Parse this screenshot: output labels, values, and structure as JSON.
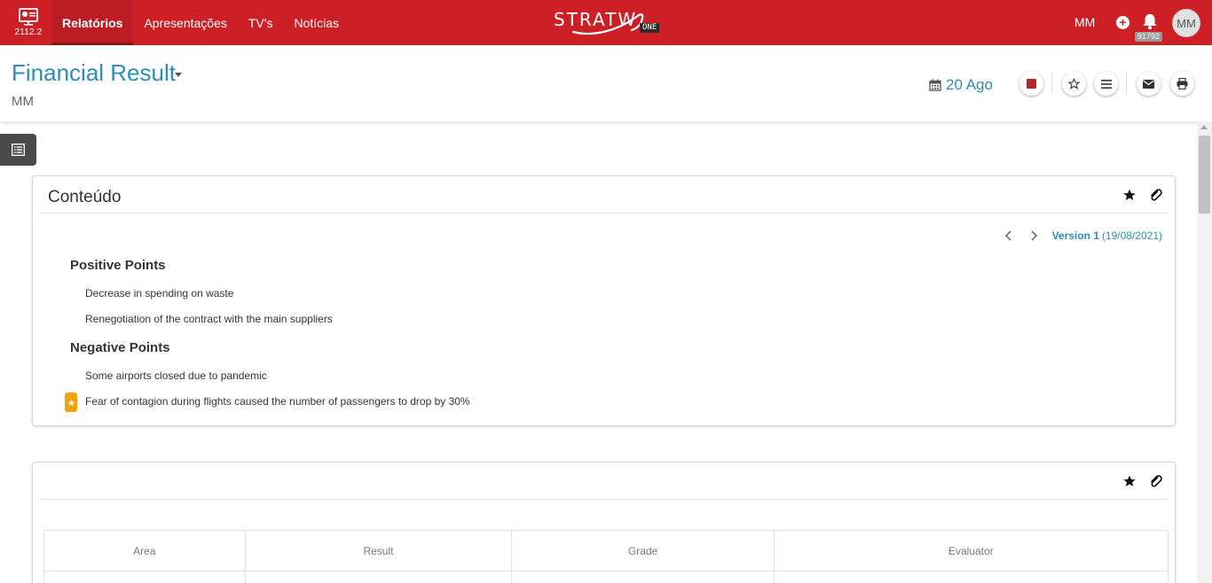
{
  "app": {
    "version": "2112.2",
    "brand_word": "STRATW",
    "brand_badge": "ONE",
    "accent_color": "#cc1f26",
    "link_color": "#2a8fb4"
  },
  "nav": {
    "items": [
      {
        "label": "Relatórios",
        "active": true
      },
      {
        "label": "Apresentações",
        "active": false
      },
      {
        "label": "TV's",
        "active": false
      },
      {
        "label": "Notícias",
        "active": false
      }
    ]
  },
  "user": {
    "initials": "MM",
    "avatar_initials": "MM",
    "notification_count": "91792"
  },
  "header": {
    "title": "Financial Result",
    "subtitle": "MM",
    "date": "20 Ago"
  },
  "content_card": {
    "title": "Conteúdo",
    "version_label": "Version 1",
    "version_date": "(19/08/2021)",
    "positive": {
      "heading": "Positive Points",
      "items": [
        "Decrease in spending on waste",
        "Renegotiation of the contract with the main suppliers"
      ]
    },
    "negative": {
      "heading": "Negative Points",
      "items": [
        "Some airports closed due to pandemic",
        "Fear of contagion during flights caused the number of passengers to drop by 30%"
      ]
    }
  },
  "table_card": {
    "columns": [
      "Area",
      "Result",
      "Grade",
      "Evaluator"
    ]
  },
  "icons": {
    "logo": "report-screen-icon",
    "add": "plus-circle-icon",
    "notifications": "bell-icon",
    "calendar": "calendar-icon",
    "stop": "stop-square-icon",
    "favorite": "star-outline-icon",
    "menu": "hamburger-icon",
    "email": "envelope-icon",
    "print": "printer-icon",
    "sidebar_toggle": "list-icon",
    "card_star": "star-icon",
    "card_attach": "paperclip-icon",
    "prev": "chevron-left-icon",
    "next": "chevron-right-icon"
  }
}
